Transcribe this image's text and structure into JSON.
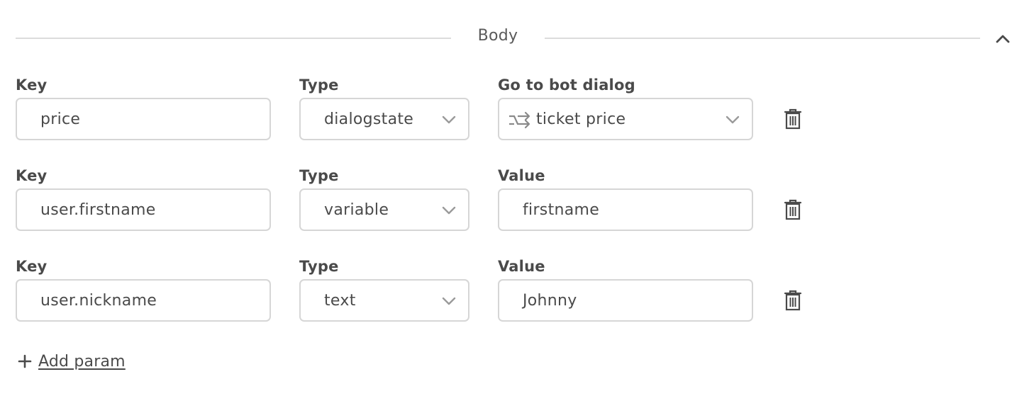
{
  "section": {
    "title": "Body"
  },
  "params": [
    {
      "key_label": "Key",
      "key_value": "price",
      "type_label": "Type",
      "type_value": "dialogstate",
      "value_label": "Go to bot dialog",
      "value_value": "ticket price",
      "value_icon": "dialog-jump-icon"
    },
    {
      "key_label": "Key",
      "key_value": "user.firstname",
      "type_label": "Type",
      "type_value": "variable",
      "value_label": "Value",
      "value_value": "firstname"
    },
    {
      "key_label": "Key",
      "key_value": "user.nickname",
      "type_label": "Type",
      "type_value": "text",
      "value_label": "Value",
      "value_value": "Johnny"
    }
  ],
  "add_param": {
    "label": "Add param"
  },
  "colors": {
    "border": "#d6d6d6",
    "text": "#4a4a4a",
    "divider": "#dcdcdc",
    "icon": "#9a9a9a"
  }
}
